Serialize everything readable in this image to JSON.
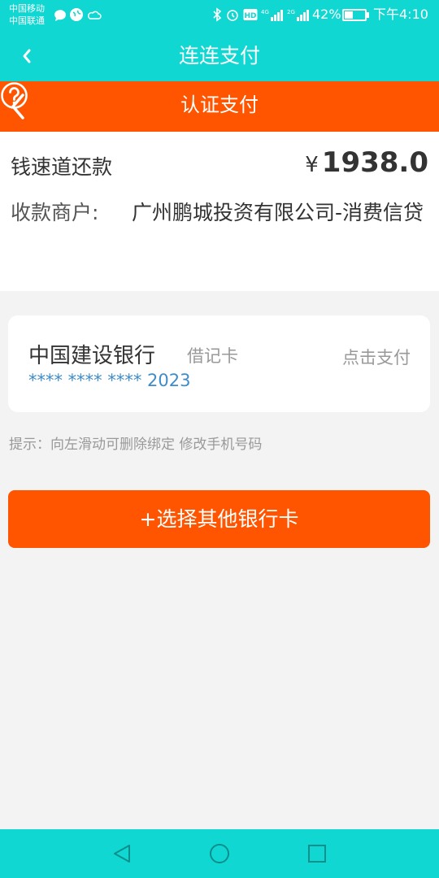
{
  "status_bar": {
    "carrier1": "中国移动",
    "carrier2": "中国联通",
    "battery": "42%",
    "battery_level": 0.42,
    "time": "下午4:10",
    "net1": "4G",
    "net2": "2G"
  },
  "app_header": {
    "title": "连连支付"
  },
  "page_header": {
    "title": "认证支付"
  },
  "order": {
    "repay_label": "钱速道还款",
    "currency": "¥",
    "amount": "1938.0",
    "payee_label": "收款商户:",
    "payee": "广州鹏城投资有限公司-消费信贷"
  },
  "card": {
    "bank": "中国建设银行",
    "type": "借记卡",
    "number": "**** **** **** 2023",
    "pay_label": "点击支付"
  },
  "tip": "提示：向左滑动可删除绑定 修改手机号码",
  "choose_button": "+选择其他银行卡",
  "colors": {
    "teal": "#10d7d2",
    "orange": "#ff5500",
    "card_number": "#3f8cc8"
  },
  "icons": [
    "back-icon",
    "help-icon",
    "nav-back-icon",
    "nav-home-icon",
    "nav-recents-icon"
  ]
}
